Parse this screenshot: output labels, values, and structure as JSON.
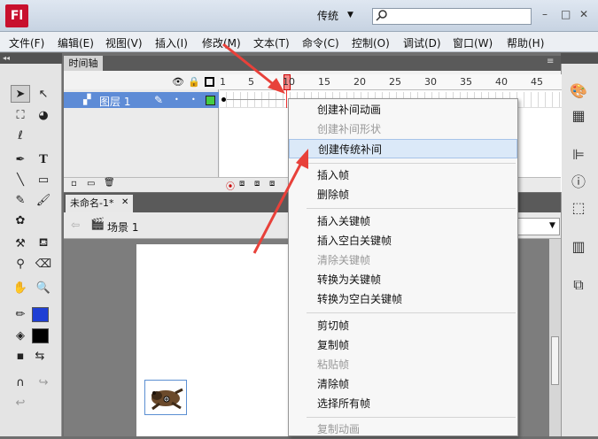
{
  "app": {
    "logo": "Fl",
    "workspace": "传统",
    "win_controls": [
      "–",
      "□",
      "✕"
    ]
  },
  "menu": [
    "文件(F)",
    "编辑(E)",
    "视图(V)",
    "插入(I)",
    "修改(M)",
    "文本(T)",
    "命令(C)",
    "控制(O)",
    "调试(D)",
    "窗口(W)",
    "帮助(H)"
  ],
  "timeline": {
    "tab": "时间轴",
    "layer": "图层 1",
    "ruler": [
      "1",
      "5",
      "10",
      "15",
      "20",
      "25",
      "30",
      "35",
      "40",
      "45"
    ]
  },
  "document": {
    "tab": "未命名-1*",
    "scene": "场景 1"
  },
  "context_menu": {
    "items": [
      "创建补间动画",
      "创建补间形状",
      "创建传统补间",
      "插入帧",
      "删除帧",
      "插入关键帧",
      "插入空白关键帧",
      "清除关键帧",
      "转换为关键帧",
      "转换为空白关键帧",
      "剪切帧",
      "复制帧",
      "粘贴帧",
      "清除帧",
      "选择所有帧",
      "复制动画"
    ]
  },
  "colors": {
    "arrow": "#e8413a",
    "stroke_color": "#1f3fd4",
    "fill_color": "#000000",
    "layer_selected": "#5d8bd6",
    "layer_color_box": "#44cc44"
  },
  "icons": {
    "tools": [
      "selection-icon",
      "subselection-icon",
      "free-transform-icon",
      "3d-rotation-icon",
      "lasso-icon",
      "pen-icon",
      "text-icon",
      "line-icon",
      "rectangle-icon",
      "pencil-icon",
      "brush-icon",
      "deco-icon",
      "bone-icon",
      "paint-bucket-icon",
      "eyedropper-icon",
      "eraser-icon",
      "hand-icon",
      "zoom-icon"
    ]
  }
}
